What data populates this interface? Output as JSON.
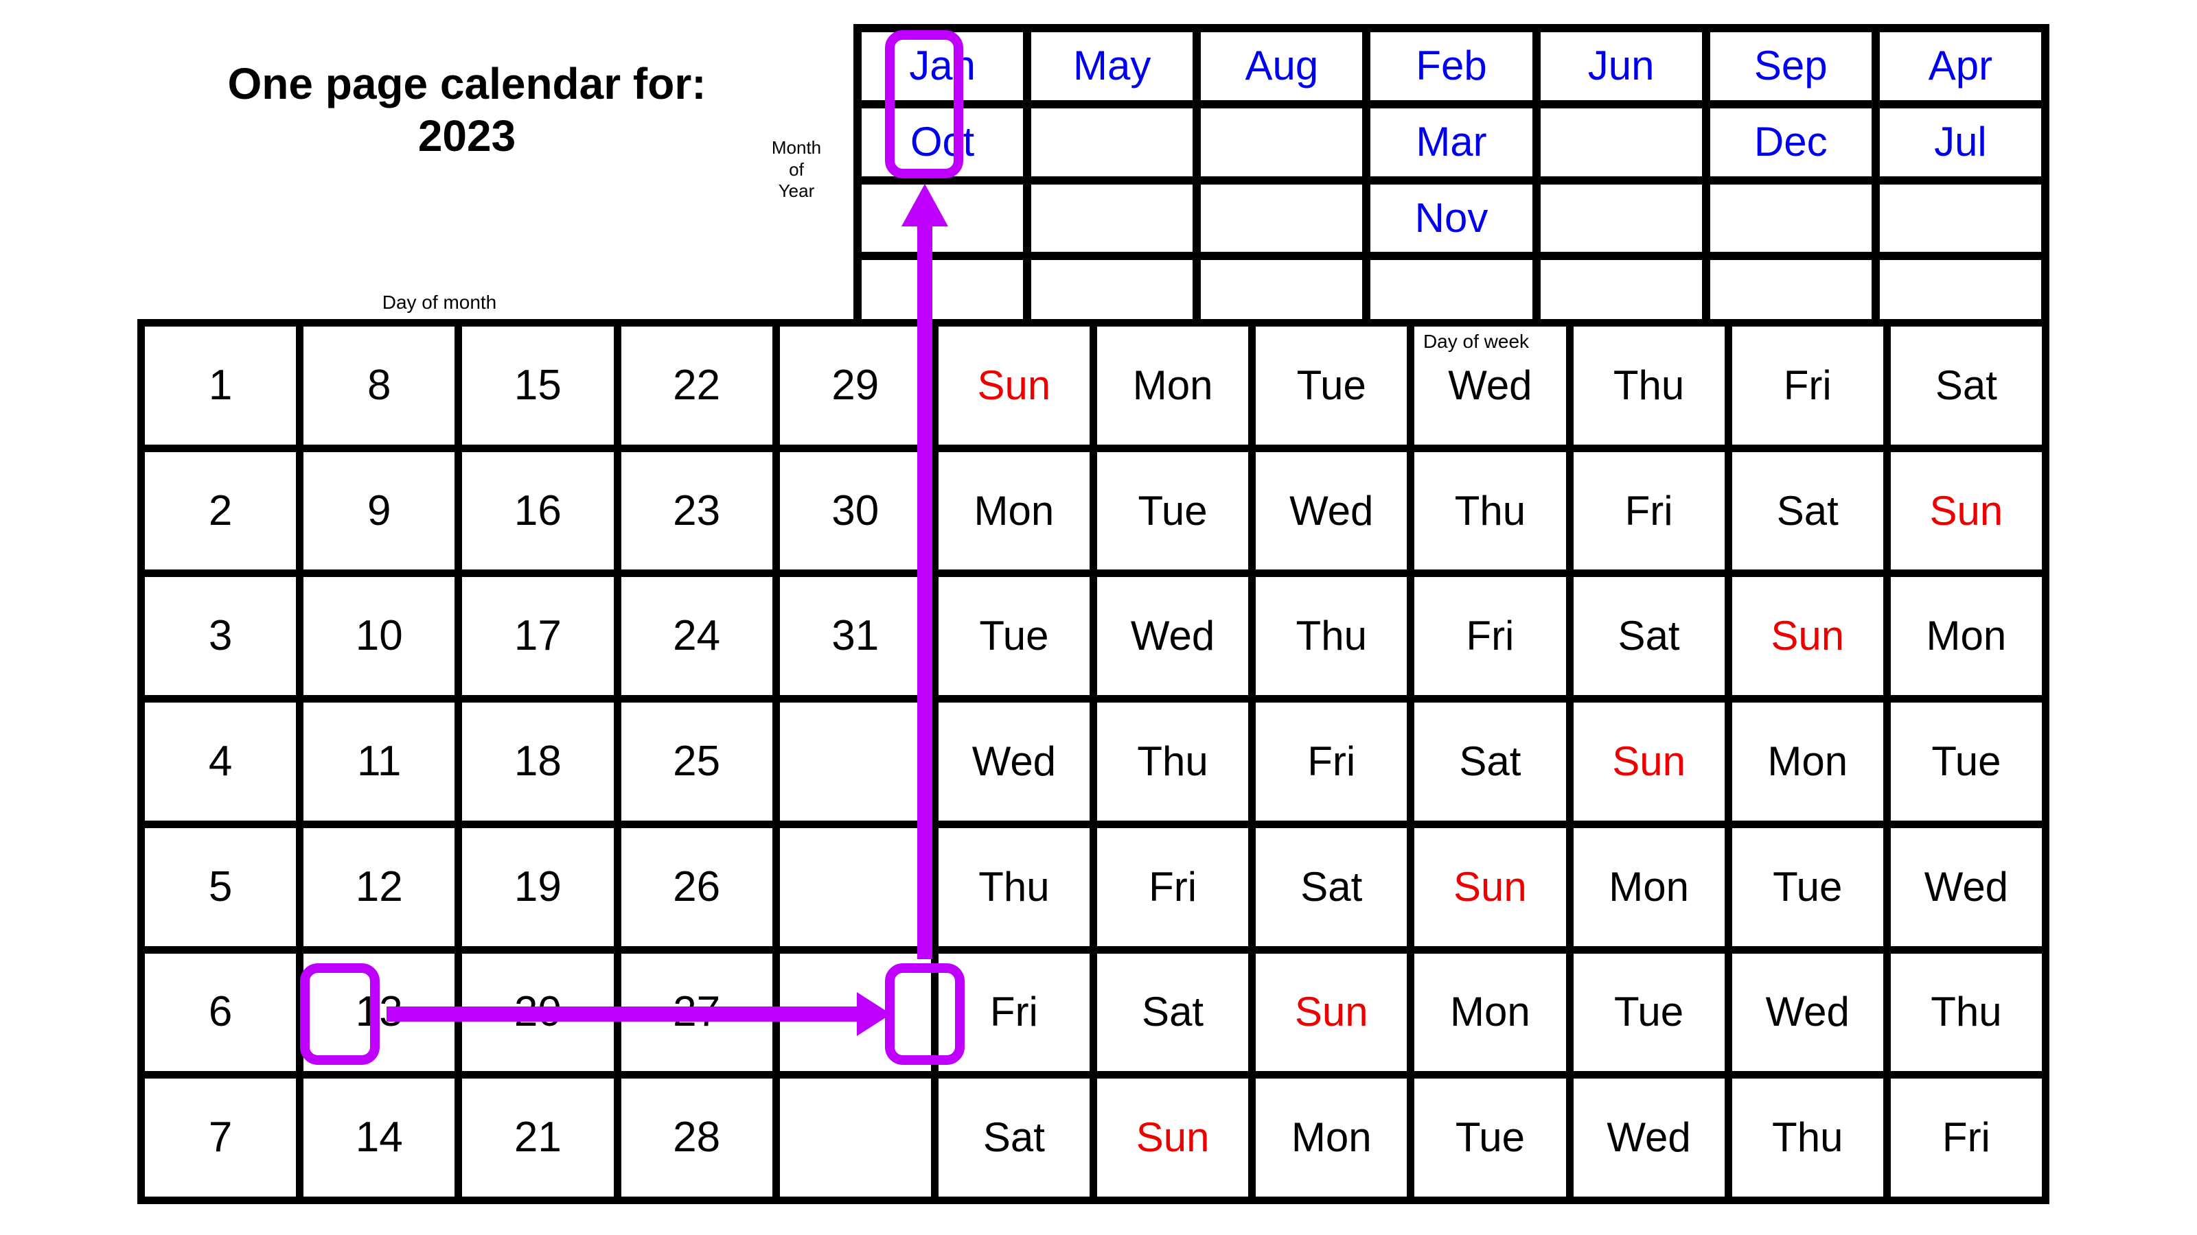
{
  "title": {
    "line1": "One page calendar for:",
    "line2": "2023"
  },
  "labels": {
    "month_of_year": [
      "Month",
      "of",
      "Year"
    ],
    "day_of_month": "Day of month",
    "day_of_week": "Day of week"
  },
  "colors": {
    "month_text": "#0000EE",
    "sunday_text": "#EE0000",
    "highlight": "#BF00FF",
    "grid_line": "#000000",
    "cell_background": "#FFFFFF",
    "page_background": "#FFFFFF"
  },
  "month_grid": {
    "columns": 7,
    "rows": 4,
    "cells": [
      [
        "Jan",
        "May",
        "Aug",
        "Feb",
        "Jun",
        "Sep",
        "Apr"
      ],
      [
        "Oct",
        "",
        "",
        "Mar",
        "",
        "Dec",
        "Jul"
      ],
      [
        "",
        "",
        "",
        "Nov",
        "",
        "",
        ""
      ],
      [
        "",
        "",
        "",
        "",
        "",
        "",
        ""
      ]
    ],
    "highlighted": [
      "Jan",
      "Oct"
    ]
  },
  "day_of_month_grid": {
    "columns": 5,
    "rows": 7,
    "cells": [
      [
        "1",
        "8",
        "15",
        "22",
        "29"
      ],
      [
        "2",
        "9",
        "16",
        "23",
        "30"
      ],
      [
        "3",
        "10",
        "17",
        "24",
        "31"
      ],
      [
        "4",
        "11",
        "18",
        "25",
        ""
      ],
      [
        "5",
        "12",
        "19",
        "26",
        ""
      ],
      [
        "6",
        "13",
        "20",
        "27",
        ""
      ],
      [
        "7",
        "14",
        "21",
        "28",
        ""
      ]
    ],
    "highlighted": "13"
  },
  "day_of_week_grid": {
    "columns": 7,
    "rows": 7,
    "cells": [
      [
        "Sun",
        "Mon",
        "Tue",
        "Wed",
        "Thu",
        "Fri",
        "Sat"
      ],
      [
        "Mon",
        "Tue",
        "Wed",
        "Thu",
        "Fri",
        "Sat",
        "Sun"
      ],
      [
        "Tue",
        "Wed",
        "Thu",
        "Fri",
        "Sat",
        "Sun",
        "Mon"
      ],
      [
        "Wed",
        "Thu",
        "Fri",
        "Sat",
        "Sun",
        "Mon",
        "Tue"
      ],
      [
        "Thu",
        "Fri",
        "Sat",
        "Sun",
        "Mon",
        "Tue",
        "Wed"
      ],
      [
        "Fri",
        "Sat",
        "Sun",
        "Mon",
        "Tue",
        "Wed",
        "Thu"
      ],
      [
        "Sat",
        "Sun",
        "Mon",
        "Tue",
        "Wed",
        "Thu",
        "Fri"
      ]
    ],
    "highlighted": "Fri",
    "highlighted_row": 6,
    "highlighted_column": 1
  },
  "annotation": {
    "lookup_day": "13",
    "lookup_weekday": "Fri",
    "lookup_month_column": [
      "Jan",
      "Oct"
    ],
    "arrow_horizontal": "from day 13 to Fri",
    "arrow_vertical": "from Fri up to Jan/Oct"
  }
}
